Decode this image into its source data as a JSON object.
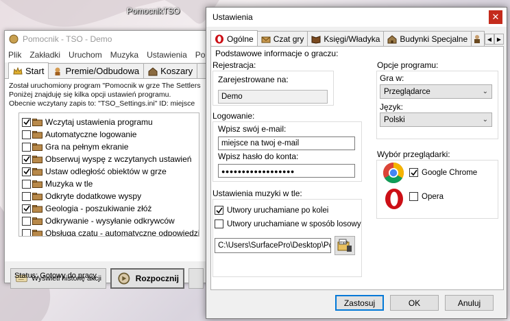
{
  "desktop": {
    "label": "PomocnikTSO"
  },
  "back_window": {
    "title": "Pomocnik - TSO - Demo",
    "menu": [
      "Plik",
      "Zakładki",
      "Uruchom",
      "Muzyka",
      "Ustawienia",
      "Po"
    ],
    "tabs": [
      {
        "label": "Start",
        "active": true
      },
      {
        "label": "Premie/Odbudowa",
        "active": false
      },
      {
        "label": "Koszary",
        "active": false
      }
    ],
    "info_lines": [
      "Został uruchomiony program \"Pomocnik w grze The Settlers",
      "Poniżej znajduję się kilka opcji ustawień programu.",
      "Obecnie wczytany zapis to: \"TSO_Settings.ini\" ID: miejsce"
    ],
    "options": [
      {
        "label": "Wczytaj ustawienia programu",
        "checked": true
      },
      {
        "label": "Automatyczne logowanie",
        "checked": false
      },
      {
        "label": "Gra na pełnym ekranie",
        "checked": false
      },
      {
        "label": "Obserwuj wyspę z wczytanych ustawień",
        "checked": true
      },
      {
        "label": "Ustaw odległość obiektów w grze",
        "checked": true
      },
      {
        "label": "Muzyka w tle",
        "checked": false
      },
      {
        "label": "Odkryte dodatkowe wyspy",
        "checked": false
      },
      {
        "label": "Geologia - poszukiwanie złóż",
        "checked": true
      },
      {
        "label": "Odkrywanie - wysyłanie odkrywców",
        "checked": false
      },
      {
        "label": "Obsługa czatu - automatyczne odpowiedzi",
        "checked": false
      }
    ],
    "buttons": {
      "history": "Wyświetl historię akcji",
      "start": "Rozpocznij"
    },
    "status": "Status: Gotowy do pracy"
  },
  "settings_window": {
    "title": "Ustawienia",
    "close_symbol": "✕",
    "tabs": [
      {
        "label": "Ogólne",
        "active": true
      },
      {
        "label": "Czat gry",
        "active": false
      },
      {
        "label": "Księgi/Władyka",
        "active": false
      },
      {
        "label": "Budynki Specjalne",
        "active": false
      }
    ],
    "general": {
      "heading": "Podstawowe informacje o graczu:",
      "registration": {
        "group_label": "Rejestracja:",
        "field_label": "Zarejestrowane na:",
        "value": "Demo"
      },
      "login": {
        "group_label": "Logowanie:",
        "email_label": "Wpisz swój e-mail:",
        "email_value": "miejsce na twoj e-mail",
        "password_label": "Wpisz hasło do konta:",
        "password_value": "●●●●●●●●●●●●●●●●●●"
      },
      "music": {
        "group_label": "Ustawienia muzyki w tle:",
        "sequential": {
          "label": "Utwory uruchamiane po kolei",
          "checked": true
        },
        "random": {
          "label": "Utwory uruchamiane w sposób losowy",
          "checked": false
        },
        "path": "C:\\Users\\SurfacePro\\Desktop\\Por"
      },
      "program_options": {
        "group_label": "Opcje programu:",
        "play_in_label": "Gra w:",
        "play_in_value": "Przeglądarce",
        "language_label": "Język:",
        "language_value": "Polski"
      },
      "browser": {
        "group_label": "Wybór przeglądarki:",
        "chrome": {
          "label": "Google Chrome",
          "checked": true
        },
        "opera": {
          "label": "Opera",
          "checked": false
        }
      }
    },
    "buttons": {
      "apply": "Zastosuj",
      "ok": "OK",
      "cancel": "Anuluj"
    }
  },
  "colors": {
    "close_red": "#c42b1c",
    "focus_blue": "#0078d7",
    "opera_red": "#cc0f16"
  }
}
